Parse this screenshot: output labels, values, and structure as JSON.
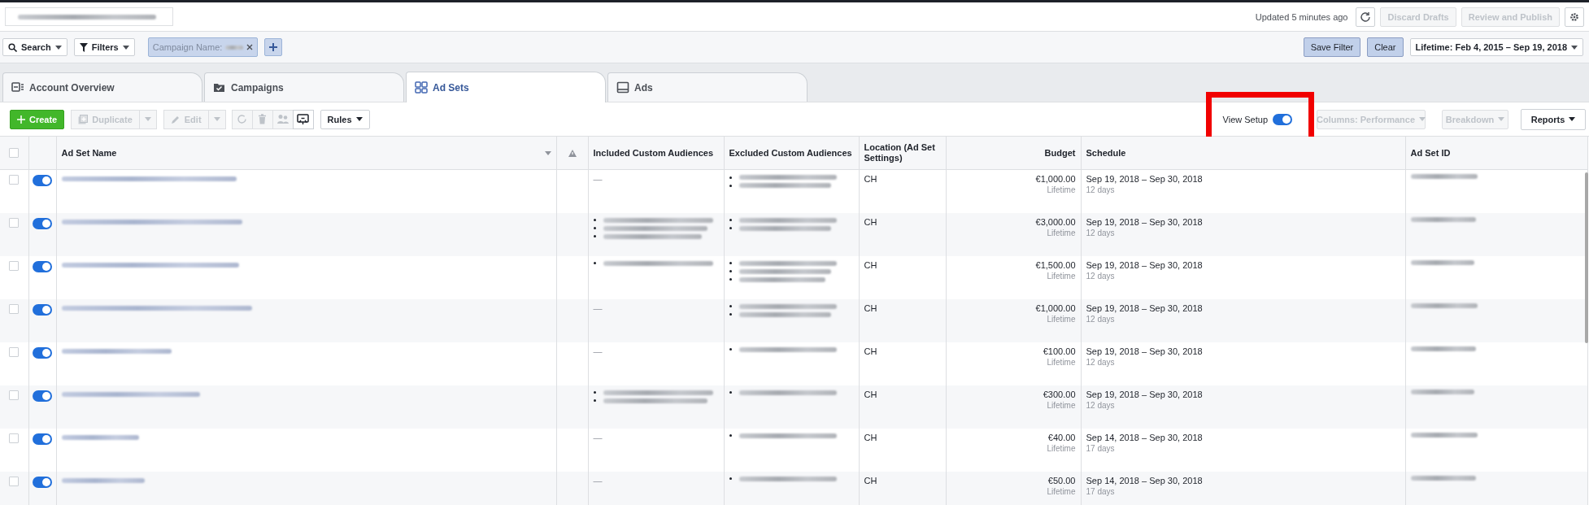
{
  "top_bar": {
    "account_field": {
      "redacted": true
    },
    "updated": "Updated 5 minutes ago",
    "buttons": [
      {
        "label": "Discard Drafts",
        "disabled": true
      },
      {
        "label": "Review and Publish",
        "disabled": true
      }
    ]
  },
  "filter_bar": {
    "search": "Search",
    "filters": "Filters",
    "chip": {
      "label": "Campaign Name:",
      "value_redacted": true
    },
    "save_filter": "Save Filter",
    "clear": "Clear",
    "date_range": "Lifetime: Feb 4, 2015 – Sep 19, 2018"
  },
  "tabs": [
    {
      "kind": "overview",
      "label": "Account Overview",
      "selected": false
    },
    {
      "kind": "campaigns",
      "label": "Campaigns",
      "selected": false
    },
    {
      "kind": "adsets",
      "label": "Ad Sets",
      "selected": true
    },
    {
      "kind": "ads",
      "label": "Ads",
      "selected": false
    }
  ],
  "toolbar": {
    "create": "Create",
    "duplicate": {
      "label": "Duplicate",
      "disabled": true
    },
    "edit": {
      "label": "Edit",
      "disabled": true
    },
    "rules": "Rules",
    "view_setup": {
      "label": "View Setup",
      "on": true
    },
    "columns": {
      "label": "Columns: Performance",
      "disabled": true
    },
    "breakdown": {
      "label": "Breakdown",
      "disabled": true
    },
    "reports": "Reports",
    "highlight_box": true
  },
  "table": {
    "columns": [
      {
        "kind": "select",
        "checked": false
      },
      {
        "kind": "toggle"
      },
      {
        "kind": "text",
        "label": "Ad Set Name",
        "sort": true
      },
      {
        "kind": "warning"
      },
      {
        "kind": "text",
        "label": "Included Custom Audiences"
      },
      {
        "kind": "text",
        "label": "Excluded Custom Audiences"
      },
      {
        "kind": "text",
        "label": "Location (Ad Set Settings)"
      },
      {
        "kind": "num",
        "label": "Budget"
      },
      {
        "kind": "text",
        "label": "Schedule"
      },
      {
        "kind": "text",
        "label": "Ad Set ID"
      }
    ],
    "rows": [
      {
        "checked": false,
        "on": true,
        "name_redacted": true,
        "included": {
          "kind": "dash",
          "text": "—"
        },
        "excluded": {
          "kind": "list",
          "entries": [
            {
              "redacted": true
            },
            {
              "redacted": true
            }
          ]
        },
        "location": "CH",
        "budget": "€1,000.00",
        "budget_type": "Lifetime",
        "schedule": "Sep 19, 2018 – Sep 30, 2018",
        "duration": "12 days",
        "id_redacted": true
      },
      {
        "checked": false,
        "on": true,
        "name_redacted": true,
        "included": {
          "kind": "list",
          "entries": [
            {
              "redacted": true
            },
            {
              "redacted": true
            },
            {
              "redacted": true
            }
          ]
        },
        "excluded": {
          "kind": "list",
          "entries": [
            {
              "redacted": true
            },
            {
              "redacted": true
            }
          ]
        },
        "location": "CH",
        "budget": "€3,000.00",
        "budget_type": "Lifetime",
        "schedule": "Sep 19, 2018 – Sep 30, 2018",
        "duration": "12 days",
        "id_redacted": true
      },
      {
        "checked": false,
        "on": true,
        "name_redacted": true,
        "included": {
          "kind": "list",
          "entries": [
            {
              "redacted": true
            }
          ]
        },
        "excluded": {
          "kind": "list",
          "entries": [
            {
              "redacted": true
            },
            {
              "redacted": true
            },
            {
              "redacted": true
            }
          ]
        },
        "location": "CH",
        "budget": "€1,500.00",
        "budget_type": "Lifetime",
        "schedule": "Sep 19, 2018 – Sep 30, 2018",
        "duration": "12 days",
        "id_redacted": true
      },
      {
        "checked": false,
        "on": true,
        "name_redacted": true,
        "included": {
          "kind": "dash",
          "text": "—"
        },
        "excluded": {
          "kind": "list",
          "entries": [
            {
              "redacted": true
            },
            {
              "redacted": true
            }
          ]
        },
        "location": "CH",
        "budget": "€1,000.00",
        "budget_type": "Lifetime",
        "schedule": "Sep 19, 2018 – Sep 30, 2018",
        "duration": "12 days",
        "id_redacted": true
      },
      {
        "checked": false,
        "on": true,
        "name_redacted": true,
        "included": {
          "kind": "dash",
          "text": "—"
        },
        "excluded": {
          "kind": "list",
          "entries": [
            {
              "redacted": true
            }
          ]
        },
        "location": "CH",
        "budget": "€100.00",
        "budget_type": "Lifetime",
        "schedule": "Sep 19, 2018 – Sep 30, 2018",
        "duration": "12 days",
        "id_redacted": true
      },
      {
        "checked": false,
        "on": true,
        "name_redacted": true,
        "included": {
          "kind": "list",
          "entries": [
            {
              "redacted": true
            },
            {
              "redacted": true
            }
          ]
        },
        "excluded": {
          "kind": "list",
          "entries": [
            {
              "redacted": true
            }
          ]
        },
        "location": "CH",
        "budget": "€300.00",
        "budget_type": "Lifetime",
        "schedule": "Sep 19, 2018 – Sep 30, 2018",
        "duration": "12 days",
        "id_redacted": true
      },
      {
        "checked": false,
        "on": true,
        "name_redacted": true,
        "included": {
          "kind": "dash",
          "text": "—"
        },
        "excluded": {
          "kind": "list",
          "entries": [
            {
              "redacted": true
            }
          ]
        },
        "location": "CH",
        "budget": "€40.00",
        "budget_type": "Lifetime",
        "schedule": "Sep 14, 2018 – Sep 30, 2018",
        "duration": "17 days",
        "id_redacted": true
      },
      {
        "checked": false,
        "on": true,
        "name_redacted": true,
        "included": {
          "kind": "dash",
          "text": "—"
        },
        "excluded": {
          "kind": "list",
          "entries": [
            {
              "redacted": true
            }
          ]
        },
        "location": "CH",
        "budget": "€50.00",
        "budget_type": "Lifetime",
        "schedule": "Sep 14, 2018 – Sep 30, 2018",
        "duration": "17 days",
        "id_redacted": true
      }
    ]
  }
}
